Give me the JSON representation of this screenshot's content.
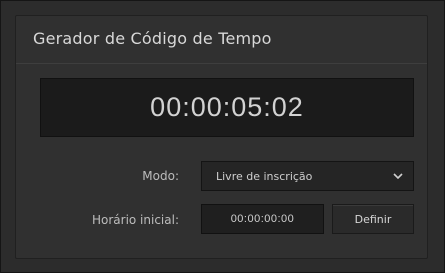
{
  "panel": {
    "title": "Gerador de Código de Tempo",
    "timecode_display": "00:00:05:02"
  },
  "mode": {
    "label": "Modo:",
    "selected_value": "Livre de inscrição",
    "arrow_icon": "chevron-down-icon"
  },
  "initial_time": {
    "label": "Horário inicial:",
    "value": "00:00:00:00",
    "reset_button_label": "Definir"
  },
  "colors": {
    "panel_bg": "#2c2c2c",
    "display_bg": "#1b1b1b",
    "text": "#d2d2d2"
  }
}
